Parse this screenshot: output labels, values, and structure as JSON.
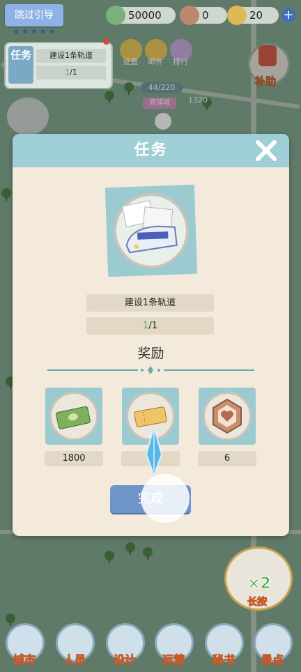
{
  "topbar": {
    "skip_label": "跳过引导",
    "money": "50000",
    "hearts": "0",
    "tickets": "20",
    "plus": "+"
  },
  "quest_card": {
    "badge": "任务",
    "task": "建设1条轨道",
    "progress_done": "1",
    "progress_total": "/1"
  },
  "map": {
    "buttons": [
      "设置",
      "邮件",
      "排行"
    ],
    "subsidy": "补助",
    "population": "44/220",
    "shop_label": "商铺域",
    "coin_value": "1320",
    "boost_label": "长按",
    "boost_mult": "×2"
  },
  "dialog": {
    "title": "任务",
    "task_name": "建设1条轨道",
    "progress_done": "1",
    "progress_total": "/1",
    "reward_title": "奖励",
    "rewards": [
      {
        "icon": "cash-stack-icon",
        "value": "1800"
      },
      {
        "icon": "ticket-icon",
        "value": ""
      },
      {
        "icon": "heart-medal-icon",
        "value": "6"
      }
    ],
    "complete_label": "完成"
  },
  "bottom_nav": [
    "城市",
    "人员",
    "设计",
    "运营",
    "秘书",
    "景点"
  ],
  "colors": {
    "header": "#9fcfd6",
    "panel": "#f3eadb",
    "button": "#6f95c8",
    "progress_green": "#4caf50"
  }
}
